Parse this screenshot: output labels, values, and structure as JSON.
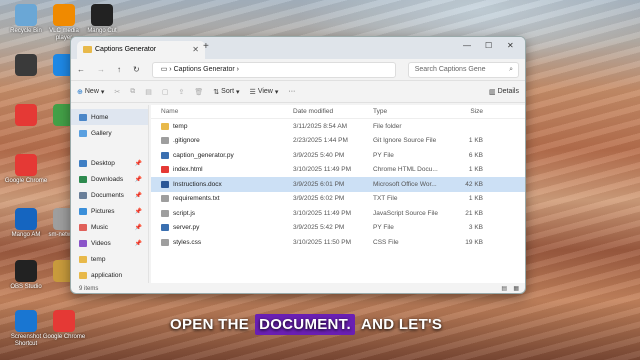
{
  "desktop": {
    "icons": [
      {
        "label": "Recycle Bin",
        "color": "#6aa7d6"
      },
      {
        "label": "VLC media player",
        "color": "#f08a00"
      },
      {
        "label": "Mango Cut",
        "color": "#222222"
      },
      {
        "label": "",
        "color": "#3a3a3a"
      },
      {
        "label": "",
        "color": "#1e88e5"
      },
      {
        "label": "",
        "color": "#e53935"
      },
      {
        "label": "",
        "color": "#43a047"
      },
      {
        "label": "Google Chrome",
        "color": "#e53935"
      },
      {
        "label": "Mango AM",
        "color": "#1565c0"
      },
      {
        "label": "sm-network",
        "color": "#9e9e9e"
      },
      {
        "label": "OBS Studio",
        "color": "#222222"
      },
      {
        "label": "",
        "color": "#c89b3c"
      },
      {
        "label": "Screenshot Shortcut",
        "color": "#1976d2"
      },
      {
        "label": "Google Chrome",
        "color": "#e53935"
      }
    ]
  },
  "window": {
    "tab_title": "Captions Generator",
    "breadcrumb": "Captions Generator",
    "search_placeholder": "Search Captions Gene"
  },
  "toolbar": {
    "new_label": "New",
    "sort_label": "Sort",
    "view_label": "View",
    "details_label": "Details"
  },
  "sidebar": {
    "items": [
      {
        "label": "Home",
        "color": "#4a86c8",
        "pinned": false,
        "selected": true
      },
      {
        "label": "Gallery",
        "color": "#5aa0e0",
        "pinned": false,
        "selected": false
      },
      {
        "label": "Desktop",
        "color": "#3f7fc4",
        "pinned": true,
        "selected": false
      },
      {
        "label": "Downloads",
        "color": "#2d8a4e",
        "pinned": true,
        "selected": false
      },
      {
        "label": "Documents",
        "color": "#6a7f99",
        "pinned": true,
        "selected": false
      },
      {
        "label": "Pictures",
        "color": "#3b8fd9",
        "pinned": true,
        "selected": false
      },
      {
        "label": "Music",
        "color": "#e0605a",
        "pinned": true,
        "selected": false
      },
      {
        "label": "Videos",
        "color": "#8b55c9",
        "pinned": true,
        "selected": false
      },
      {
        "label": "temp",
        "color": "#e8b94a",
        "pinned": false,
        "selected": false
      },
      {
        "label": "application",
        "color": "#e8b94a",
        "pinned": false,
        "selected": false
      }
    ]
  },
  "table": {
    "headers": [
      "Name",
      "Date modified",
      "Type",
      "Size"
    ],
    "rows": [
      {
        "name": "temp",
        "date": "3/11/2025 8:54 AM",
        "type": "File folder",
        "size": "",
        "color": "#e8b94a",
        "hl": false
      },
      {
        "name": ".gitignore",
        "date": "2/23/2025 1:44 PM",
        "type": "Git Ignore Source File",
        "size": "1 KB",
        "color": "#9e9e9e",
        "hl": false
      },
      {
        "name": "caption_generator.py",
        "date": "3/9/2025 5:40 PM",
        "type": "PY File",
        "size": "6 KB",
        "color": "#3a6fb0",
        "hl": false
      },
      {
        "name": "index.html",
        "date": "3/10/2025 11:49 PM",
        "type": "Chrome HTML Docu...",
        "size": "1 KB",
        "color": "#e53935",
        "hl": false
      },
      {
        "name": "Instructions.docx",
        "date": "3/9/2025 6:01 PM",
        "type": "Microsoft Office Wor...",
        "size": "42 KB",
        "color": "#2b5797",
        "hl": true
      },
      {
        "name": "requirements.txt",
        "date": "3/9/2025 6:02 PM",
        "type": "TXT File",
        "size": "1 KB",
        "color": "#9e9e9e",
        "hl": false
      },
      {
        "name": "script.js",
        "date": "3/10/2025 11:49 PM",
        "type": "JavaScript Source File",
        "size": "21 KB",
        "color": "#9e9e9e",
        "hl": false
      },
      {
        "name": "server.py",
        "date": "3/9/2025 5:42 PM",
        "type": "PY File",
        "size": "3 KB",
        "color": "#3a6fb0",
        "hl": false
      },
      {
        "name": "styles.css",
        "date": "3/10/2025 11:50 PM",
        "type": "CSS File",
        "size": "19 KB",
        "color": "#9e9e9e",
        "hl": false
      }
    ]
  },
  "status": {
    "item_count": "9 items"
  },
  "caption": {
    "before": "OPEN THE",
    "highlight": "DOCUMENT.",
    "after": "AND LET'S",
    "highlight_color": "#6a1fb3"
  }
}
